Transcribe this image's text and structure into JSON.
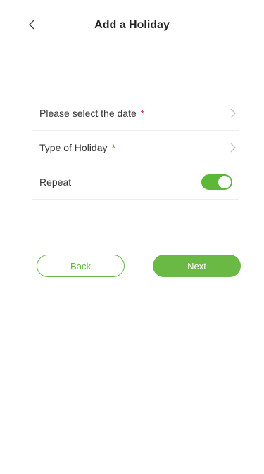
{
  "header": {
    "title": "Add a Holiday",
    "back_icon": "chevron-left-icon"
  },
  "form": {
    "rows": [
      {
        "label": "Please select the date",
        "required": "*",
        "icon": "chevron-right-icon"
      },
      {
        "label": "Type of Holiday",
        "required": "*",
        "icon": "chevron-right-icon"
      },
      {
        "label": "Repeat",
        "toggle_on": true
      }
    ]
  },
  "buttons": {
    "back_label": "Back",
    "next_label": "Next"
  },
  "colors": {
    "accent": "#5cb836",
    "required": "#d9322d"
  }
}
